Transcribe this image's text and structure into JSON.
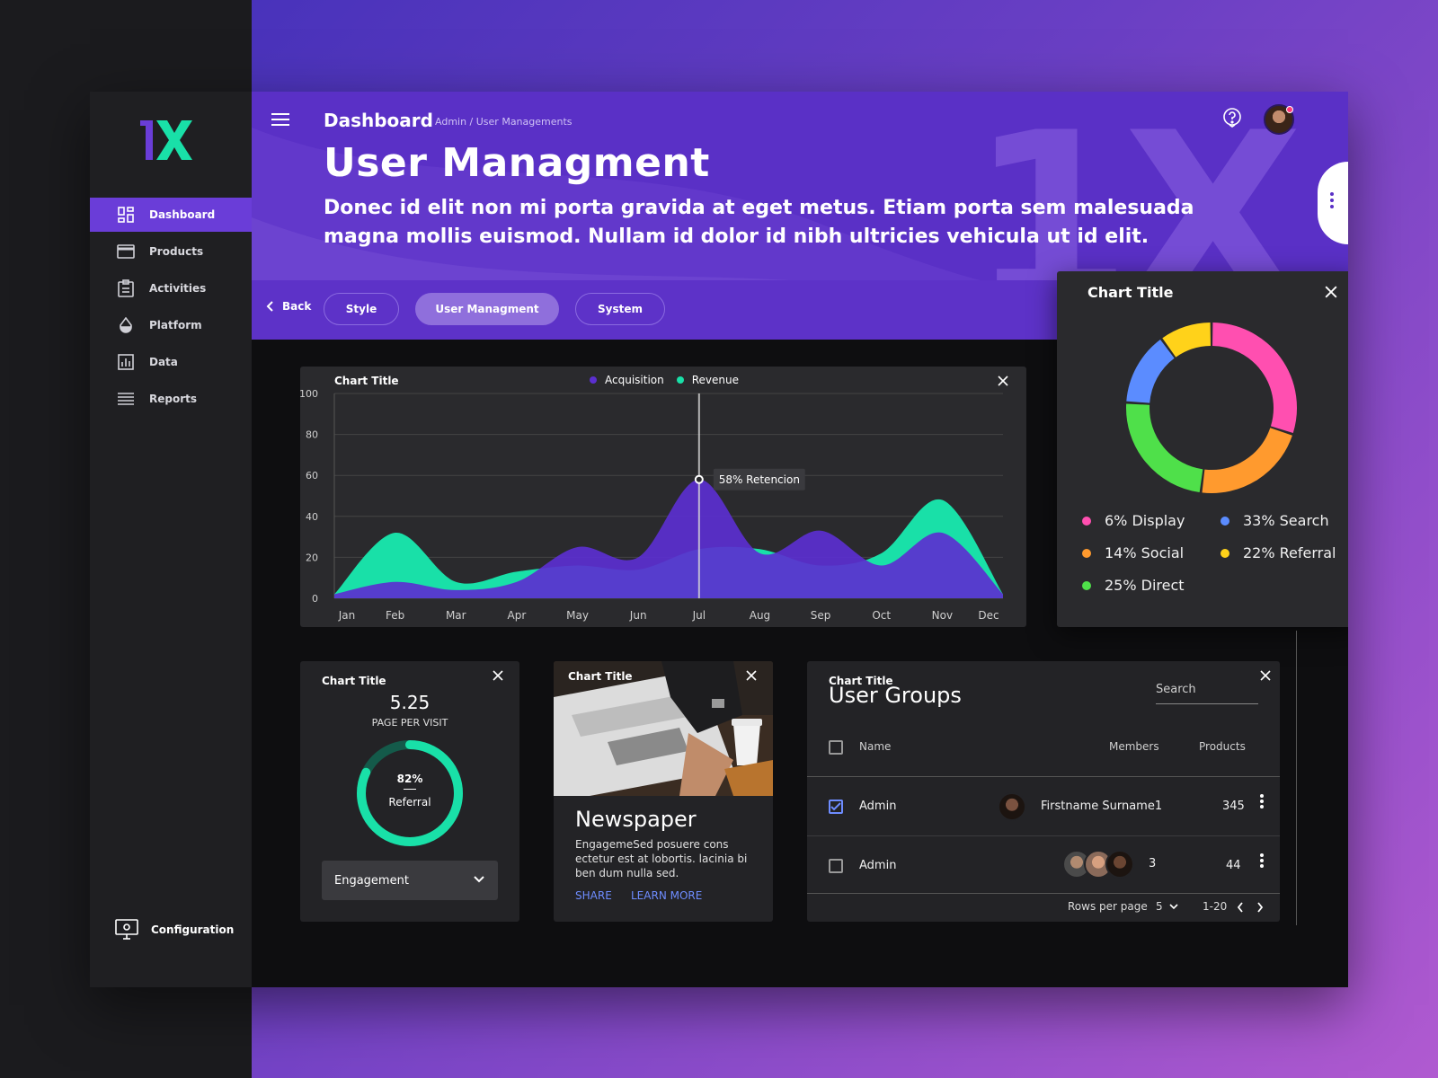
{
  "colors": {
    "accent": "#5a30c6",
    "teal": "#19e0a8",
    "purple": "#6a3dd8",
    "blue_link": "#6e8cff"
  },
  "brand": {
    "logo_text": "1X"
  },
  "sidebar": {
    "items": [
      {
        "label": "Dashboard",
        "icon": "dashboard-icon"
      },
      {
        "label": "Products",
        "icon": "card-icon"
      },
      {
        "label": "Activities",
        "icon": "clipboard-icon"
      },
      {
        "label": "Platform",
        "icon": "drop-icon"
      },
      {
        "label": "Data",
        "icon": "bar-chart-icon"
      },
      {
        "label": "Reports",
        "icon": "list-icon"
      }
    ],
    "active": "Dashboard",
    "config_label": "Configuration"
  },
  "header": {
    "title": "Dashboard",
    "breadcrumb": "Admin / User Managements",
    "page_title": "User Managment",
    "description": "Donec id elit non mi porta gravida at eget metus. Etiam porta sem malesuada magna mollis euismod. Nullam id dolor id nibh ultricies vehicula ut id elit."
  },
  "tabs": {
    "back": "Back",
    "items": [
      "Style",
      "User Managment",
      "System"
    ],
    "active": "User Managment"
  },
  "area_chart": {
    "title": "Chart Title",
    "tooltip": "58% Retencion"
  },
  "chart_data": [
    {
      "type": "area",
      "title": "Chart Title",
      "categories": [
        "Jan",
        "Feb",
        "Mar",
        "Apr",
        "May",
        "Jun",
        "Jul",
        "Aug",
        "Sep",
        "Oct",
        "Nov",
        "Dec"
      ],
      "series": [
        {
          "name": "Acquisition",
          "color": "#5b2fd0",
          "values": [
            2,
            8,
            4,
            8,
            25,
            20,
            58,
            22,
            33,
            16,
            32,
            2
          ]
        },
        {
          "name": "Revenue",
          "color": "#19e0a8",
          "values": [
            2,
            32,
            8,
            13,
            16,
            14,
            24,
            24,
            16,
            22,
            48,
            2
          ]
        }
      ],
      "ylim": [
        0,
        100
      ],
      "yticks": [
        0,
        20,
        40,
        60,
        80,
        100
      ],
      "grid": true,
      "legend": "top",
      "marker": {
        "category": "Jul",
        "label": "58% Retencion"
      }
    },
    {
      "type": "pie",
      "title": "Chart Title",
      "donut": true,
      "slices": [
        {
          "label": "Display",
          "value": 6,
          "color": "#ff4fb0"
        },
        {
          "label": "Search",
          "value": 33,
          "color": "#5b8cff"
        },
        {
          "label": "Social",
          "value": 14,
          "color": "#ff9a2e"
        },
        {
          "label": "Referral",
          "value": 22,
          "color": "#ffd21a"
        },
        {
          "label": "Direct",
          "value": 25,
          "color": "#4fe04a"
        }
      ],
      "legend": "bottom"
    }
  ],
  "donut_chart": {
    "title": "Chart Title",
    "legend": [
      "6% Display",
      "33% Search",
      "14% Social",
      "22% Referral",
      "25% Direct"
    ]
  },
  "page_visit": {
    "title": "Chart Title",
    "value": "5.25",
    "label": "PAGE PER VISIT",
    "ring_percent": "82%",
    "ring_label": "Referral",
    "ring_fraction": 0.82,
    "select_value": "Engagement"
  },
  "newspaper": {
    "title": "Chart Title",
    "heading": "Newspaper",
    "text": "EngagemeSed posuere cons ectetur est at lobortis. lacinia bi ben dum nulla sed.",
    "share": "SHARE",
    "learn_more": "LEARN MORE"
  },
  "user_groups": {
    "title": "Chart Title",
    "heading": "User Groups",
    "search_placeholder": "Search",
    "columns": [
      "Name",
      "Members",
      "Products"
    ],
    "rows": [
      {
        "checked": true,
        "name": "Admin",
        "member": "Firstname Surname1",
        "products": "345"
      },
      {
        "checked": false,
        "name": "Admin",
        "member": "3",
        "products": "44"
      }
    ],
    "rows_per_page_label": "Rows per page",
    "rows_per_page": "5",
    "range": "1-20"
  }
}
